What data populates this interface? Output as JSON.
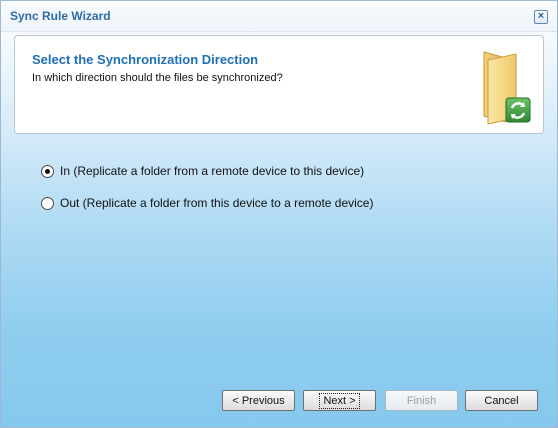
{
  "window": {
    "title": "Sync Rule Wizard",
    "close_symbol": "×"
  },
  "header": {
    "title": "Select the Synchronization Direction",
    "subtitle": "In which direction should the files be synchronized?",
    "icon": "sync-folder-icon"
  },
  "options": [
    {
      "label": "In (Replicate a folder from a remote device to this device)",
      "checked": true
    },
    {
      "label": "Out (Replicate a folder from this device to a remote device)",
      "checked": false
    }
  ],
  "buttons": {
    "previous": "< Previous",
    "next": "Next >",
    "finish": "Finish",
    "cancel": "Cancel"
  },
  "colors": {
    "title_blue": "#2e6aa8",
    "header_title_blue": "#1f6fb8",
    "background_blue": "#86c9ee"
  }
}
